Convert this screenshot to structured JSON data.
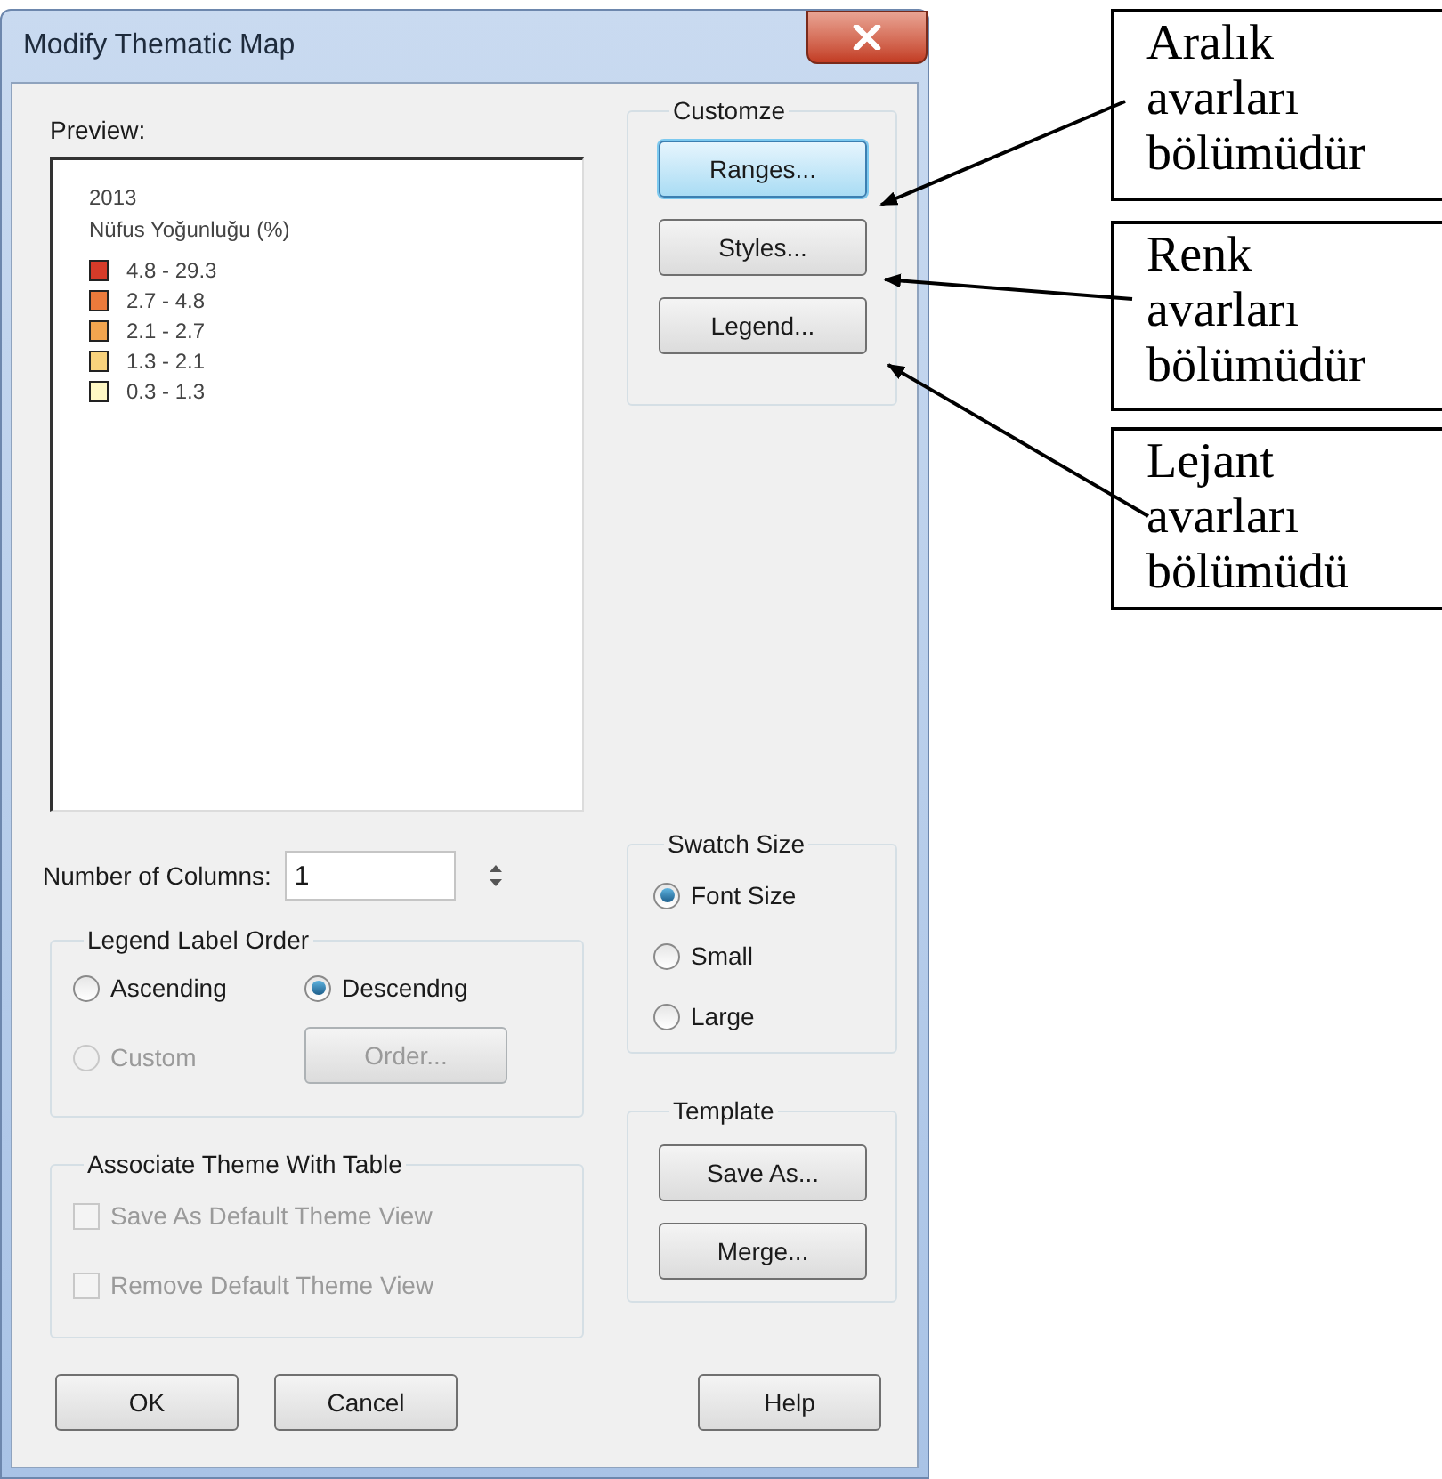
{
  "window": {
    "title": "Modify Thematic Map"
  },
  "preview": {
    "label": "Preview:",
    "legend_title": "2013",
    "legend_subtitle": "Nüfus Yoğunluğu (%)",
    "ranges": [
      {
        "label": "4.8 - 29.3",
        "color": "#d63b29"
      },
      {
        "label": "2.7 - 4.8",
        "color": "#eb7a3b"
      },
      {
        "label": "2.1 - 2.7",
        "color": "#f2a54f"
      },
      {
        "label": "1.3 - 2.1",
        "color": "#f8d27c"
      },
      {
        "label": "0.3 - 1.3",
        "color": "#fff8c4"
      }
    ]
  },
  "customize": {
    "label": "Customze",
    "buttons": [
      {
        "label": "Ranges...",
        "focused": true
      },
      {
        "label": "Styles...",
        "focused": false
      },
      {
        "label": "Legend...",
        "focused": false
      }
    ]
  },
  "columns": {
    "label": "Number of Columns:",
    "value": "1"
  },
  "legend_label_order": {
    "label": "Legend Label Order",
    "options": [
      {
        "label": "Ascending",
        "selected": false,
        "disabled": false
      },
      {
        "label": "Descendng",
        "selected": true,
        "disabled": false
      },
      {
        "label": "Custom",
        "selected": false,
        "disabled": true
      }
    ],
    "order_button": {
      "label": "Order...",
      "disabled": true
    }
  },
  "associate": {
    "label": "Associate Theme With Table",
    "checkboxes": [
      {
        "label": "Save As Default Theme View",
        "checked": false,
        "disabled": true
      },
      {
        "label": "Remove Default Theme View",
        "checked": false,
        "disabled": true
      }
    ]
  },
  "swatch_size": {
    "label": "Swatch Size",
    "options": [
      {
        "label": "Font Size",
        "selected": true
      },
      {
        "label": "Small",
        "selected": false
      },
      {
        "label": "Large",
        "selected": false
      }
    ]
  },
  "template": {
    "label": "Template",
    "buttons": [
      "Save As...",
      "Merge..."
    ]
  },
  "footer_buttons": [
    "OK",
    "Cancel",
    "Help"
  ],
  "annotations": [
    {
      "text": "Aralık\navarları\nbölümüdür"
    },
    {
      "text": "Renk\navarları\nbölümüdür"
    },
    {
      "text": "Lejant\navarları\nbölümüdü"
    }
  ]
}
